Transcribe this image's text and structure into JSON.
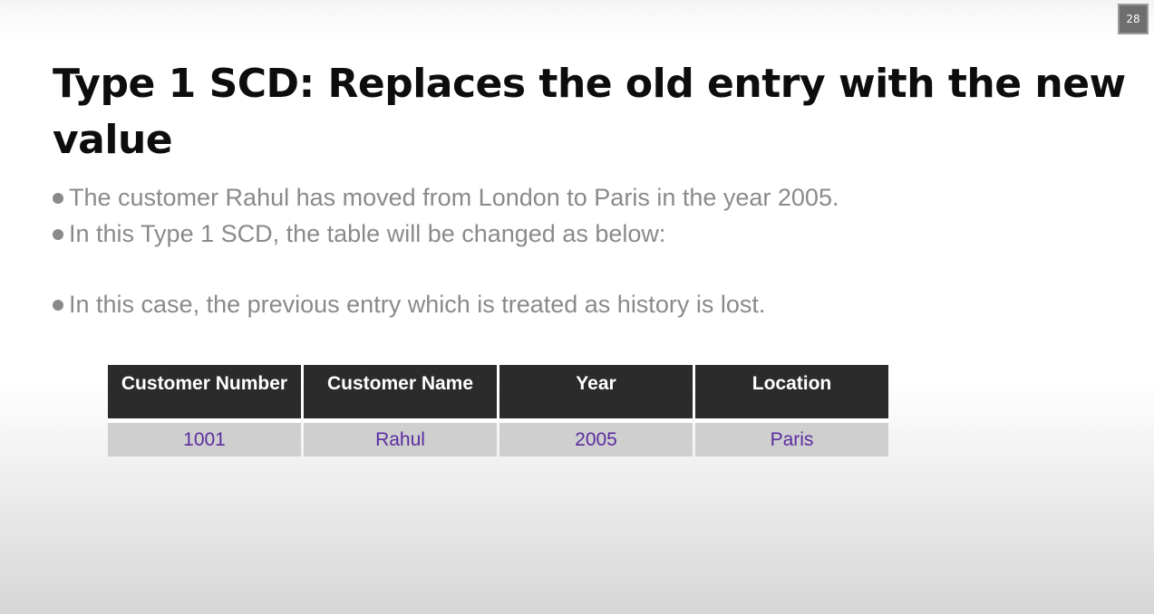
{
  "slide": {
    "number": "28",
    "title": "Type 1 SCD: Replaces the old entry with the new value",
    "bullets": [
      "The customer Rahul has moved from London to Paris in the year 2005.",
      "In this Type 1 SCD, the table will be changed as below:",
      "In this case, the previous entry which is treated as history is lost."
    ]
  },
  "table": {
    "headers": [
      "Customer Number",
      "Customer Name",
      "Year",
      "Location"
    ],
    "rows": [
      [
        "1001",
        "Rahul",
        "2005",
        "Paris"
      ]
    ]
  },
  "colors": {
    "header_bg": "#2b2b2b",
    "row_bg": "#cfcfcf",
    "cell_text": "#5b2ca0",
    "bullet_text": "#8a8a8a"
  }
}
